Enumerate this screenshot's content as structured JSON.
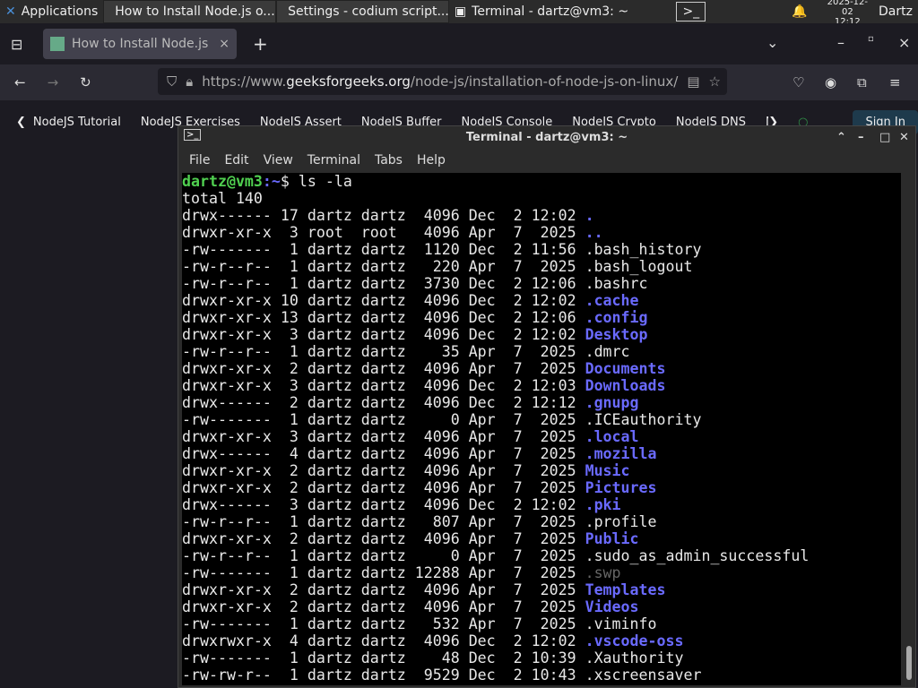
{
  "taskbar": {
    "applications": "Applications",
    "windows": [
      "How to Install Node.js o...",
      "Settings - codium script...",
      "Terminal - dartz@vm3: ~"
    ],
    "date": "2025-12-02",
    "time": "12:12",
    "user": "Dartz"
  },
  "browser": {
    "tab_title": "How to Install Node.js on",
    "url_prefix": "https://www.",
    "url_domain": "geeksforgeeks.org",
    "url_path": "/node-js/installation-of-node-js-on-linux/",
    "bookmarks": [
      "NodeJS Tutorial",
      "NodeJS Exercises",
      "NodeJS Assert",
      "NodeJS Buffer",
      "NodeJS Console",
      "NodeJS Crypto",
      "NodeJS DNS",
      "Node"
    ],
    "sign_in": "Sign In"
  },
  "terminal": {
    "title": "Terminal - dartz@vm3: ~",
    "menu": [
      "File",
      "Edit",
      "View",
      "Terminal",
      "Tabs",
      "Help"
    ],
    "prompt_user": "dartz@vm3",
    "prompt_path": ":~",
    "prompt_symbol": "$ ",
    "command": "ls -la",
    "total": "total 140",
    "entries": [
      [
        "drwx------ 17 dartz dartz  4096 Dec  2 12:02 ",
        ".",
        "dir"
      ],
      [
        "drwxr-xr-x  3 root  root   4096 Apr  7  2025 ",
        "..",
        "dir"
      ],
      [
        "-rw-------  1 dartz dartz  1120 Dec  2 11:56 ",
        ".bash_history",
        "file"
      ],
      [
        "-rw-r--r--  1 dartz dartz   220 Apr  7  2025 ",
        ".bash_logout",
        "file"
      ],
      [
        "-rw-r--r--  1 dartz dartz  3730 Dec  2 12:06 ",
        ".bashrc",
        "file"
      ],
      [
        "drwxr-xr-x 10 dartz dartz  4096 Dec  2 12:02 ",
        ".cache",
        "dir"
      ],
      [
        "drwxr-xr-x 13 dartz dartz  4096 Dec  2 12:06 ",
        ".config",
        "dir"
      ],
      [
        "drwxr-xr-x  3 dartz dartz  4096 Dec  2 12:02 ",
        "Desktop",
        "dir"
      ],
      [
        "-rw-r--r--  1 dartz dartz    35 Apr  7  2025 ",
        ".dmrc",
        "file"
      ],
      [
        "drwxr-xr-x  2 dartz dartz  4096 Apr  7  2025 ",
        "Documents",
        "dir"
      ],
      [
        "drwxr-xr-x  3 dartz dartz  4096 Dec  2 12:03 ",
        "Downloads",
        "dir"
      ],
      [
        "drwx------  2 dartz dartz  4096 Dec  2 12:12 ",
        ".gnupg",
        "dir"
      ],
      [
        "-rw-------  1 dartz dartz     0 Apr  7  2025 ",
        ".ICEauthority",
        "file"
      ],
      [
        "drwxr-xr-x  3 dartz dartz  4096 Apr  7  2025 ",
        ".local",
        "dir"
      ],
      [
        "drwx------  4 dartz dartz  4096 Apr  7  2025 ",
        ".mozilla",
        "dir"
      ],
      [
        "drwxr-xr-x  2 dartz dartz  4096 Apr  7  2025 ",
        "Music",
        "dir"
      ],
      [
        "drwxr-xr-x  2 dartz dartz  4096 Apr  7  2025 ",
        "Pictures",
        "dir"
      ],
      [
        "drwx------  3 dartz dartz  4096 Dec  2 12:02 ",
        ".pki",
        "dir"
      ],
      [
        "-rw-r--r--  1 dartz dartz   807 Apr  7  2025 ",
        ".profile",
        "file"
      ],
      [
        "drwxr-xr-x  2 dartz dartz  4096 Apr  7  2025 ",
        "Public",
        "dir"
      ],
      [
        "-rw-r--r--  1 dartz dartz     0 Apr  7  2025 ",
        ".sudo_as_admin_successful",
        "file"
      ],
      [
        "-rw-------  1 dartz dartz 12288 Apr  7  2025 ",
        ".swp",
        "dim"
      ],
      [
        "drwxr-xr-x  2 dartz dartz  4096 Apr  7  2025 ",
        "Templates",
        "dir"
      ],
      [
        "drwxr-xr-x  2 dartz dartz  4096 Apr  7  2025 ",
        "Videos",
        "dir"
      ],
      [
        "-rw-------  1 dartz dartz   532 Apr  7  2025 ",
        ".viminfo",
        "file"
      ],
      [
        "drwxrwxr-x  4 dartz dartz  4096 Dec  2 12:02 ",
        ".vscode-oss",
        "dir"
      ],
      [
        "-rw-------  1 dartz dartz    48 Dec  2 10:39 ",
        ".Xauthority",
        "file"
      ],
      [
        "-rw-rw-r--  1 dartz dartz  9529 Dec  2 10:43 ",
        ".xscreensaver",
        "file"
      ]
    ]
  }
}
